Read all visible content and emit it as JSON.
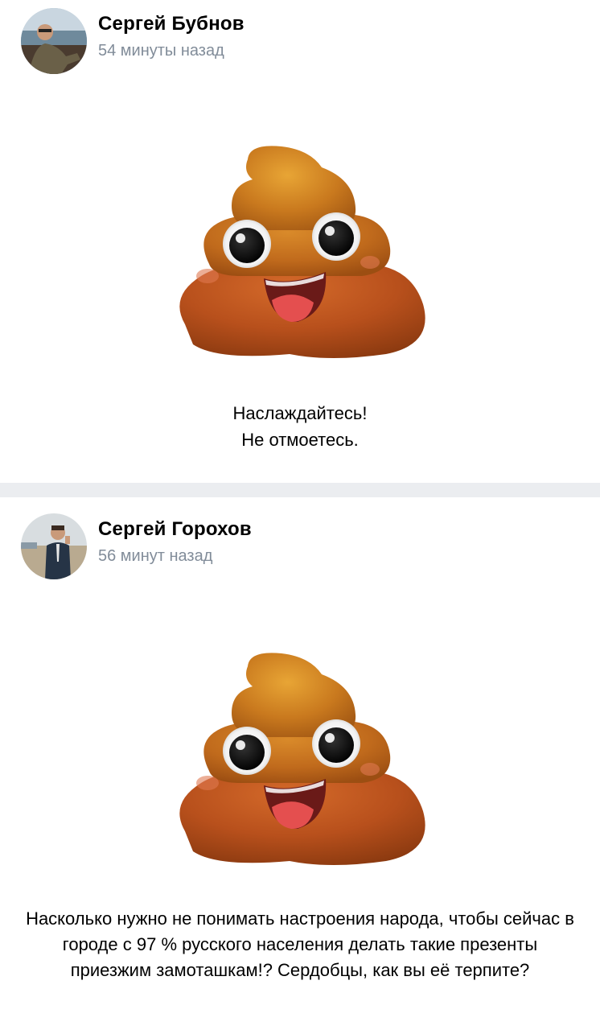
{
  "posts": [
    {
      "author": "Сергей Бубнов",
      "time": "54 минуты назад",
      "text": "Наслаждайтесь!\nНе отмоетесь."
    },
    {
      "author": "Сергей Горохов",
      "time": "56 минут назад",
      "text": "Насколько нужно не понимать настроения народа, чтобы сейчас в городе с 97 % русского населения делать такие презенты приезжим замоташкам!? Сердобцы, как вы её терпите?"
    }
  ],
  "colors": {
    "background": "#ffffff",
    "separator": "#ebedf0",
    "secondary_text": "#818c99"
  },
  "icons": {
    "emoji": "pile-of-poo-emoji"
  }
}
